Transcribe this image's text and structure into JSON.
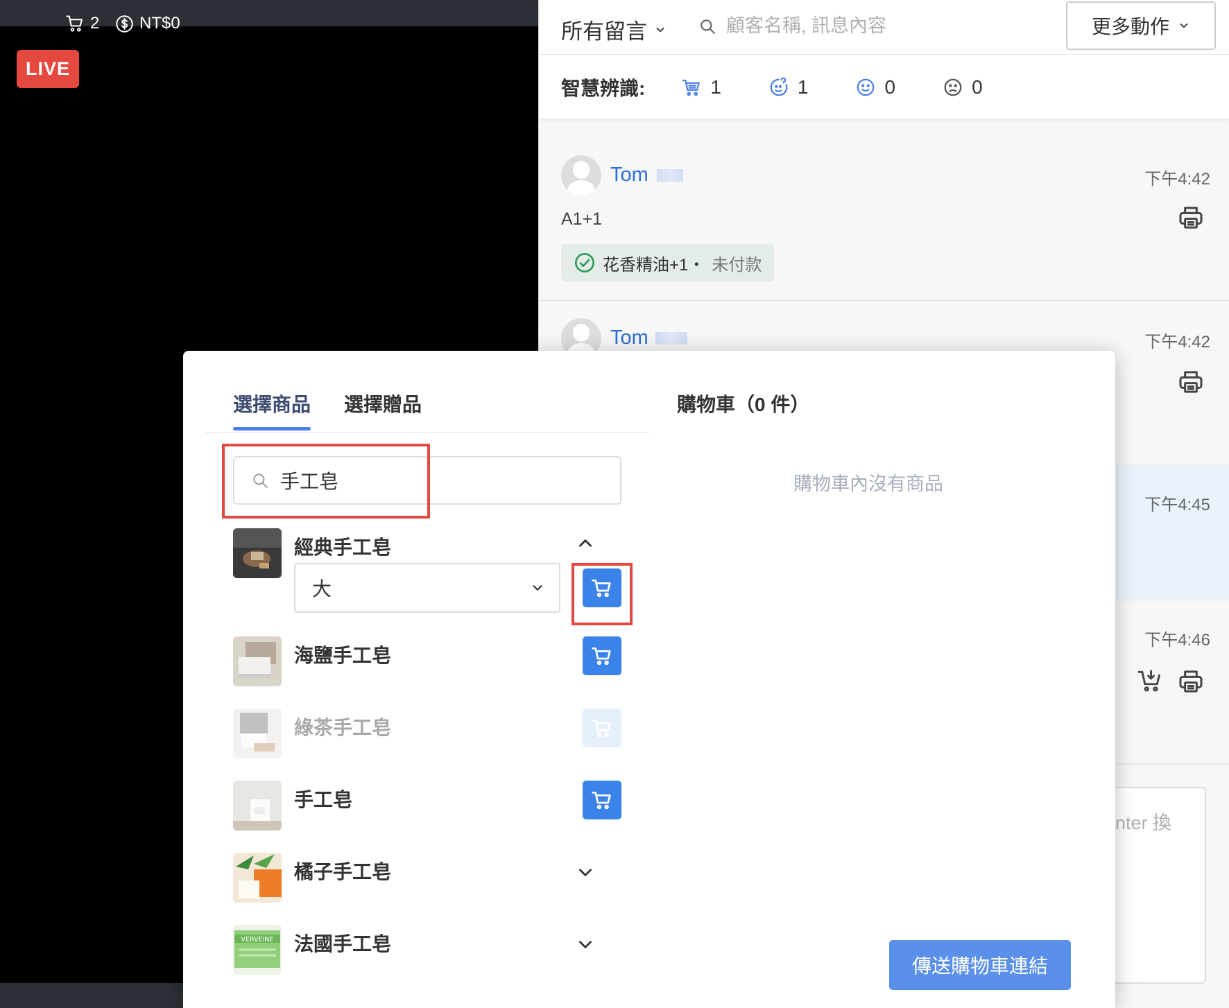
{
  "video": {
    "cart_count": "2",
    "revenue": "NT$0",
    "live_label": "LIVE"
  },
  "comments_panel": {
    "filter_label": "所有留言",
    "search_placeholder": "顧客名稱, 訊息內容",
    "more_actions_label": "更多動作",
    "smart_label": "智慧辨識:",
    "smart_counts": {
      "cart": "1",
      "question": "1",
      "positive": "0",
      "negative": "0"
    },
    "comments": [
      {
        "name": "Tom",
        "time": "下午4:42",
        "text": "A1+1",
        "order_item": "花香精油+1・",
        "order_status": "未付款"
      },
      {
        "name": "Tom",
        "time": "下午4:42"
      },
      {
        "time": "下午4:45"
      },
      {
        "time": "下午4:46"
      }
    ],
    "reply_placeholder_fragment": "nter 換"
  },
  "modal": {
    "tabs": [
      "選擇商品",
      "選擇贈品"
    ],
    "cart_title": "購物車（0 件）",
    "cart_empty": "購物車內沒有商品",
    "search_value": "手工皂",
    "products": [
      {
        "name": "經典手工皂",
        "variant": "大",
        "expanded": true,
        "disabled": false
      },
      {
        "name": "海鹽手工皂",
        "disabled": false
      },
      {
        "name": "綠茶手工皂",
        "disabled": true
      },
      {
        "name": "手工皂",
        "disabled": false
      },
      {
        "name": "橘子手工皂",
        "collapsed": true
      },
      {
        "name": "法國手工皂",
        "collapsed": true,
        "thumb_text": "VERVEINE"
      }
    ],
    "send_button": "傳送購物車連結"
  },
  "colors": {
    "primary": "#3b82e9",
    "link": "#2b6fd6",
    "live": "#e5483f",
    "highlight_box": "#e5483f",
    "send_button": "#5b90ea"
  }
}
